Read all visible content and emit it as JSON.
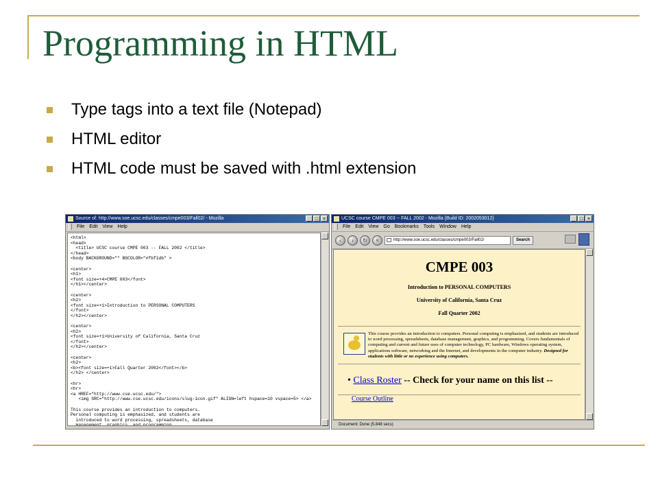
{
  "slide": {
    "title": "Programming in HTML",
    "bullets": [
      "Type tags into a text file (Notepad)",
      "HTML editor",
      "HTML code must be saved with .html extension"
    ],
    "accent_color": "#c9a94a",
    "title_color": "#1f5c3a"
  },
  "source_window": {
    "title": "Source of: http://www.soe.ucsc.edu/classes/cmpe003/Fall02/ - Mozilla",
    "menu": [
      "File",
      "Edit",
      "View",
      "Help"
    ],
    "code": "<html>\n<head>\n  <title> UCSC course CMPE 003 -- FALL 2002 </title>\n</head>\n<body BACKGROUND=\"\" BGCOLOR=\"#fbf1db\" >\n\n<center>\n<h1>\n<font size=+4>CMPE 003</font>\n</h1></center>\n\n<center>\n<h2>\n<font size=+1>Introduction to PERSONAL COMPUTERS\n</font>\n</h2></center>\n\n<center>\n<h2>\n<font size=+1>University of California, Santa Cruz\n</font>\n</h2></center>\n\n<center>\n<h2>\n<b><font size=+1>Fall Quarter 2002</font></b>\n</h2> </center>\n\n<hr>\n<hr>\n<a HREF=\"http://www.cse.ucsc.edu/\">\n   <img SRC=\"http://www.cse.ucsc.edu/icons/slug-icon.gif\" ALIGN=left hspace=10 vspace=5> </a>\n\nThis course provides an introduction to computers.\nPersonal computing is emphasized, and students are\n  introduced to word processing, spreadsheets, database\n  management, graphics, and programming."
  },
  "browser_window": {
    "title": "UCSC course CMPE 003 -- FALL 2002 - Mozilla {Build ID: 2002053012}",
    "menu": [
      "File",
      "Edit",
      "View",
      "Go",
      "Bookmarks",
      "Tools",
      "Window",
      "Help"
    ],
    "url": "http://www.soe.ucsc.edu/classes/cmpe003/Fall02/",
    "search_label": "Search",
    "page": {
      "h1": "CMPE 003",
      "h2_course": "Introduction to PERSONAL COMPUTERS",
      "h2_university": "University of California, Santa Cruz",
      "h2_term": "Fall Quarter 2002",
      "intro_text": "This course provides an introduction to computers. Personal computing is emphasized, and students are introduced to word processing, spreadsheets, database management, graphics, and programming. Covers fundamentals of computing and current and future uses of computer technology, PC hardware, Windows operating system, applications software, networking and the Internet, and developments in the computer industry. ",
      "intro_emphasis": "Designed for students with little or no experience using computers.",
      "roster_link": "Class Roster",
      "roster_text": " -- Check for your name on this list --",
      "next_link": "Course Outline"
    },
    "status": "Document: Done (5.848 secs)"
  }
}
